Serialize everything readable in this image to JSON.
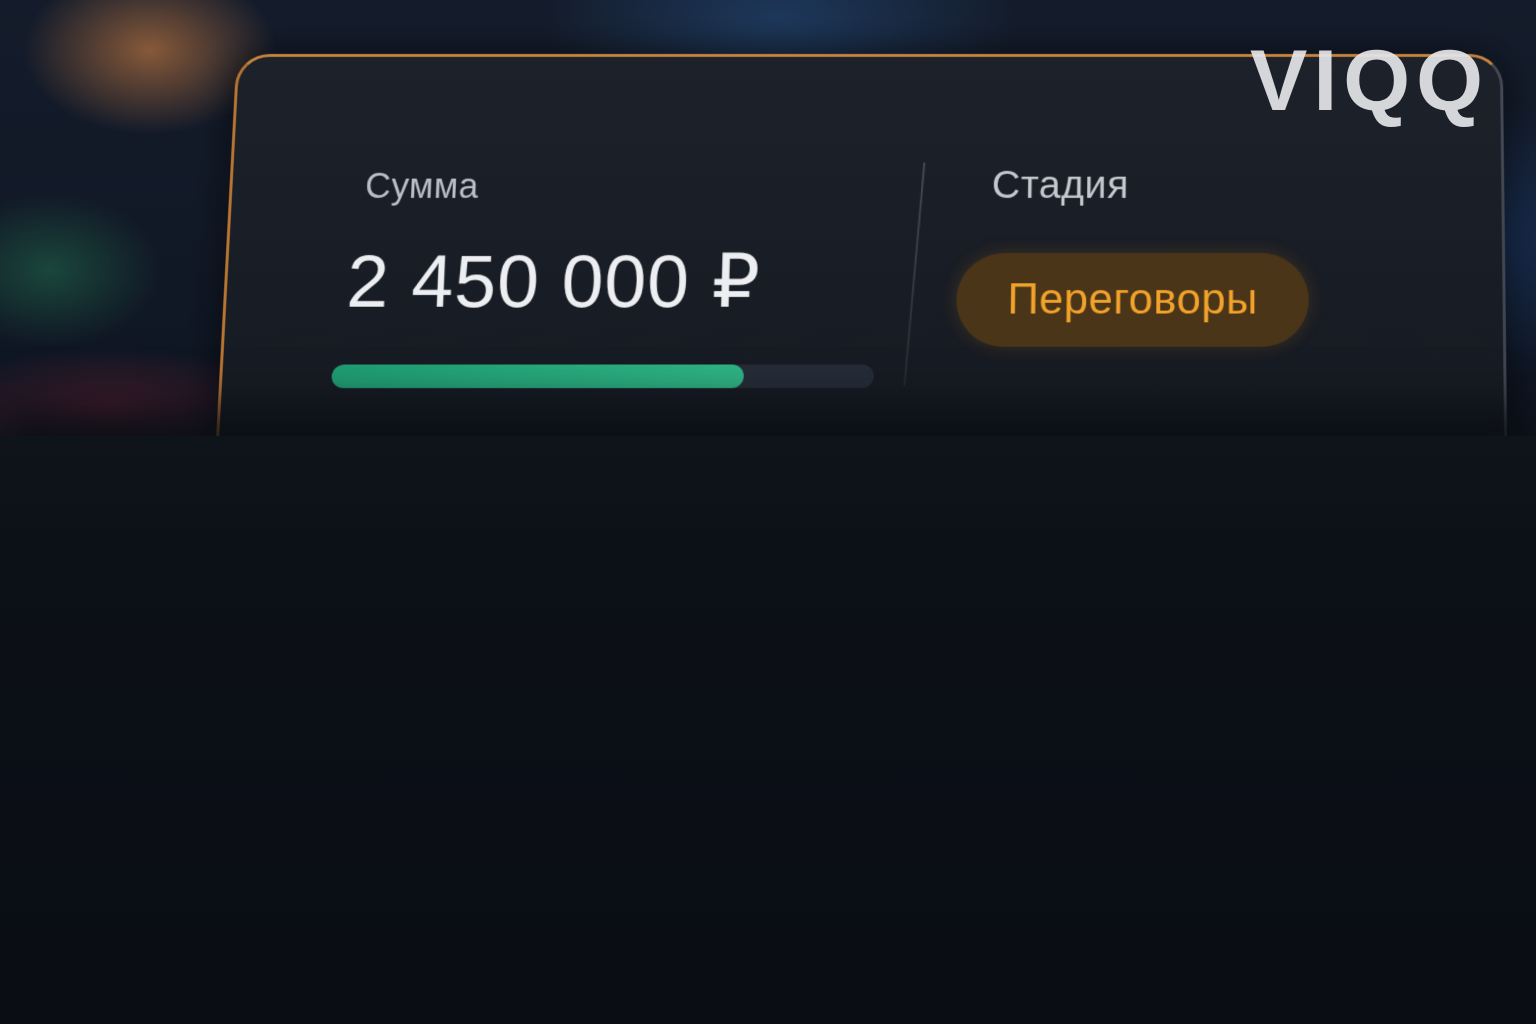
{
  "card": {
    "amount_label": "Сумма",
    "amount_value": "2 450 000 ₽",
    "progress_fraction": 0.76,
    "stage_label": "Стадия",
    "stage_value": "Переговоры"
  },
  "logo": {
    "text": "VIQQ"
  },
  "colors": {
    "accent_border": "#c9843f",
    "progress_fill": "#2fb585",
    "badge_text": "#f2a32a",
    "badge_bg": "#4a3519"
  }
}
